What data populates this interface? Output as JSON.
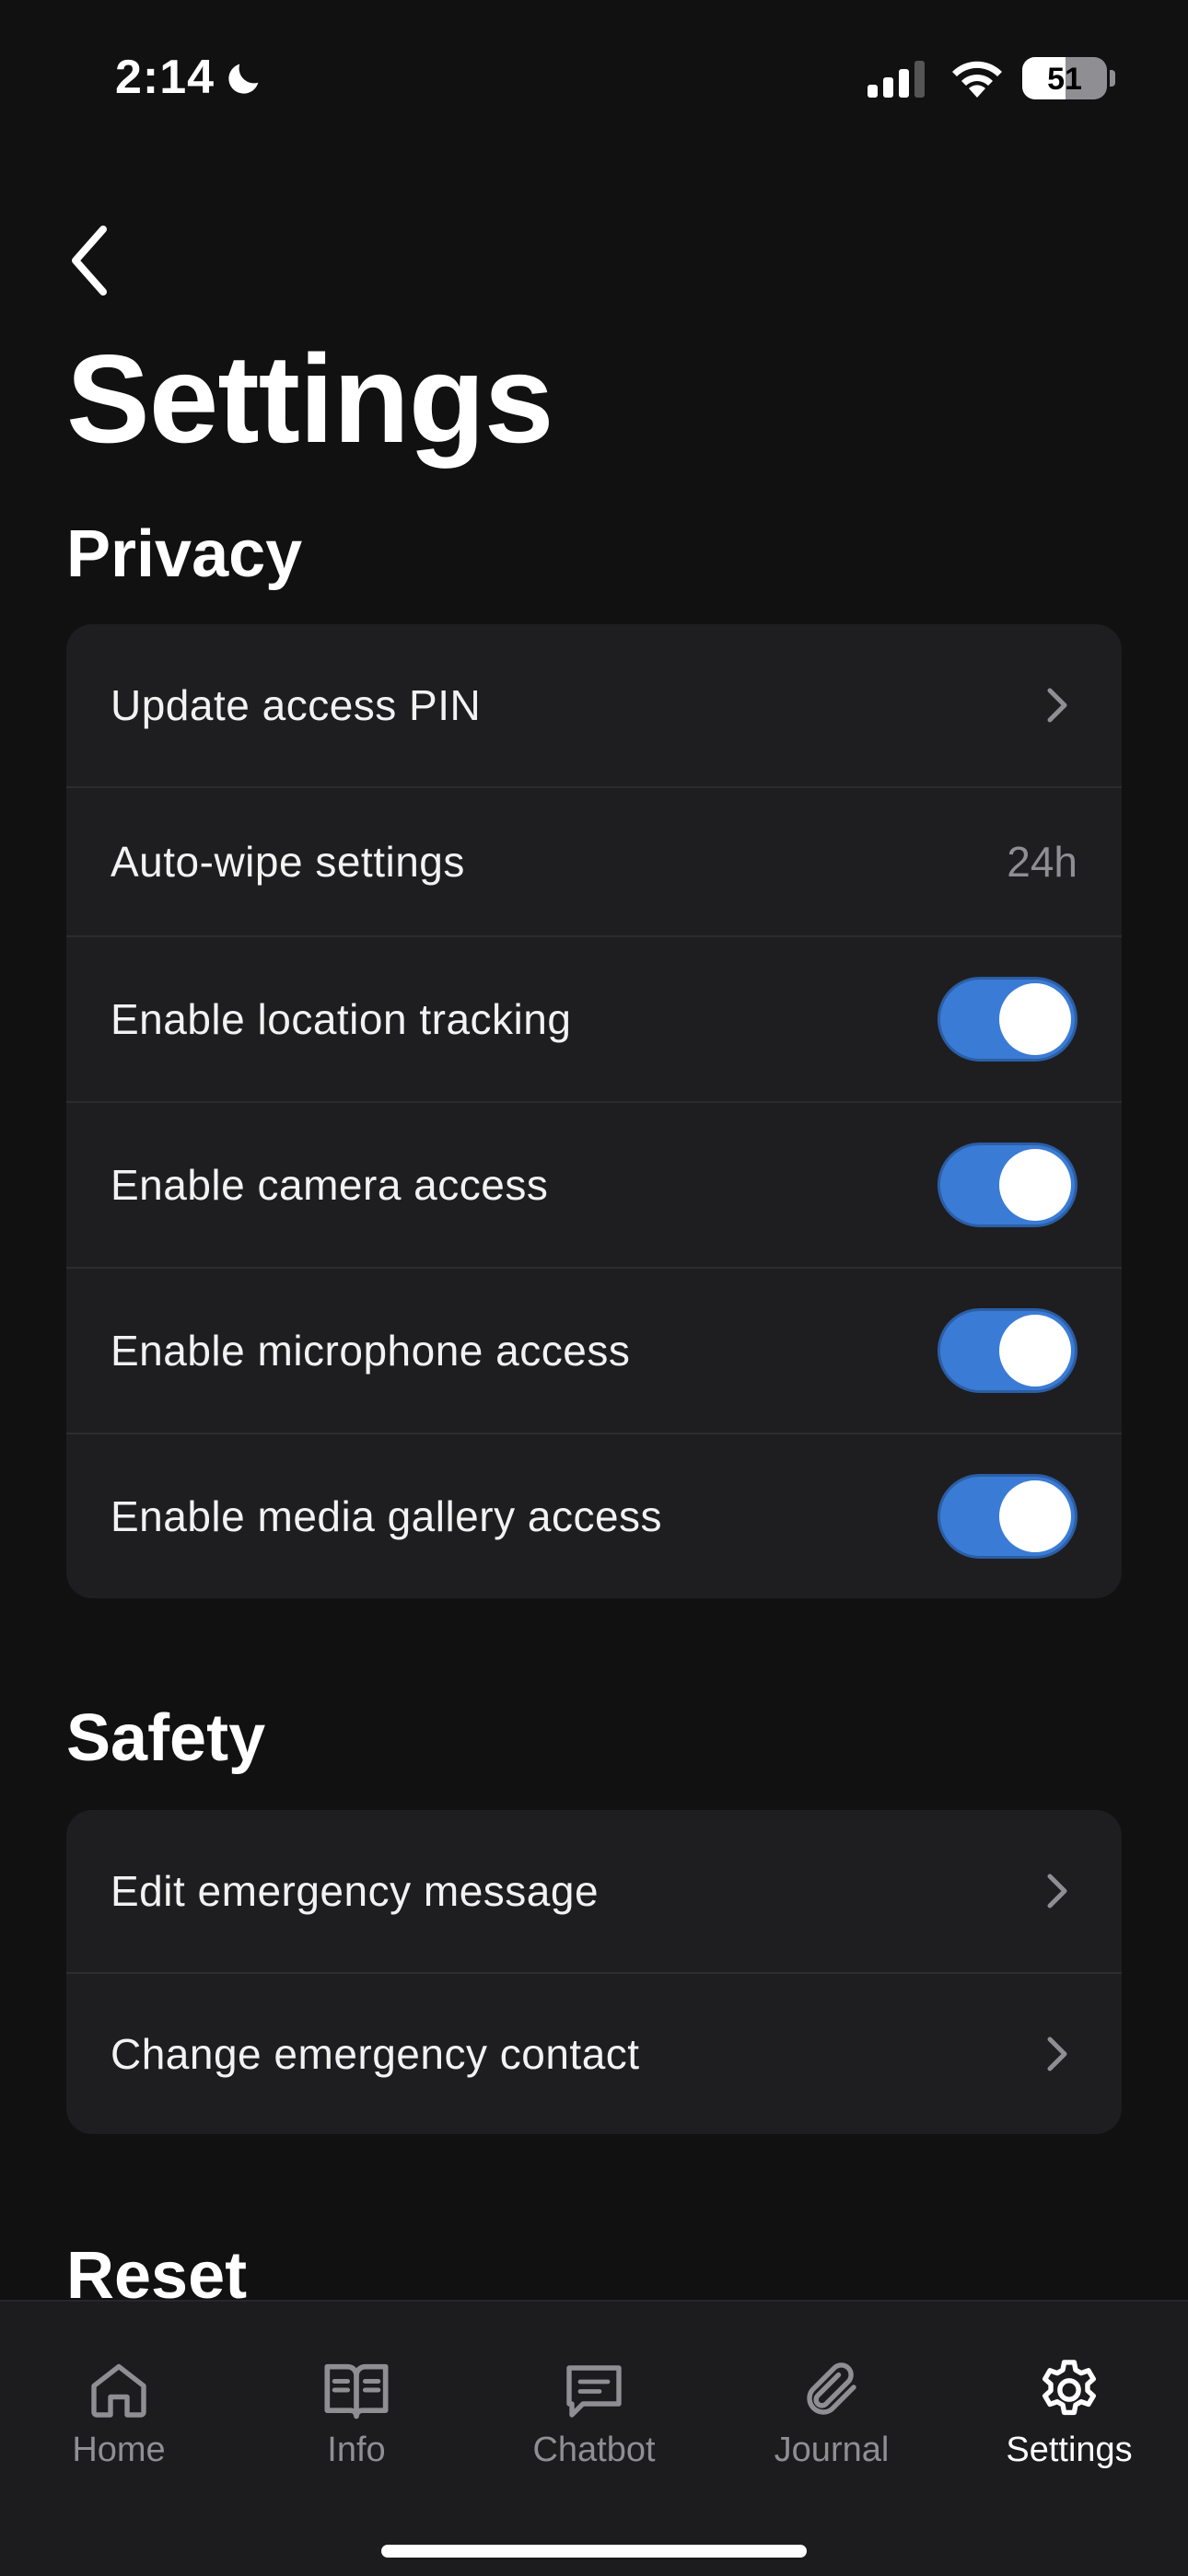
{
  "status_bar": {
    "time": "2:14",
    "battery_level": "51",
    "icons": [
      "moon-icon",
      "cellular-signal-icon",
      "wifi-icon",
      "battery-icon"
    ]
  },
  "header": {
    "back_icon": "chevron-left-icon",
    "title": "Settings"
  },
  "privacy": {
    "title": "Privacy",
    "items": [
      {
        "label": "Update access PIN",
        "accessory": "chevron-right-icon"
      },
      {
        "label": "Auto-wipe settings",
        "value": "24h"
      },
      {
        "label": "Enable location tracking",
        "toggle": true
      },
      {
        "label": "Enable camera access",
        "toggle": true
      },
      {
        "label": "Enable microphone access",
        "toggle": true
      },
      {
        "label": "Enable media gallery access",
        "toggle": true
      }
    ]
  },
  "safety": {
    "title": "Safety",
    "items": [
      {
        "label": "Edit emergency message",
        "accessory": "chevron-right-icon"
      },
      {
        "label": "Change emergency contact",
        "accessory": "chevron-right-icon"
      }
    ]
  },
  "reset": {
    "title": "Reset"
  },
  "tab_bar": {
    "tabs": [
      {
        "label": "Home",
        "icon": "home-icon",
        "active": false
      },
      {
        "label": "Info",
        "icon": "book-icon",
        "active": false
      },
      {
        "label": "Chatbot",
        "icon": "chat-bubble-icon",
        "active": false
      },
      {
        "label": "Journal",
        "icon": "paperclip-icon",
        "active": false
      },
      {
        "label": "Settings",
        "icon": "gear-icon",
        "active": true
      }
    ]
  },
  "colors": {
    "background": "#111112",
    "card": "#1e1e20",
    "accent": "#3a7bd5",
    "secondary_text": "#8e8e93",
    "tab_bar": "#1c1c1e"
  }
}
